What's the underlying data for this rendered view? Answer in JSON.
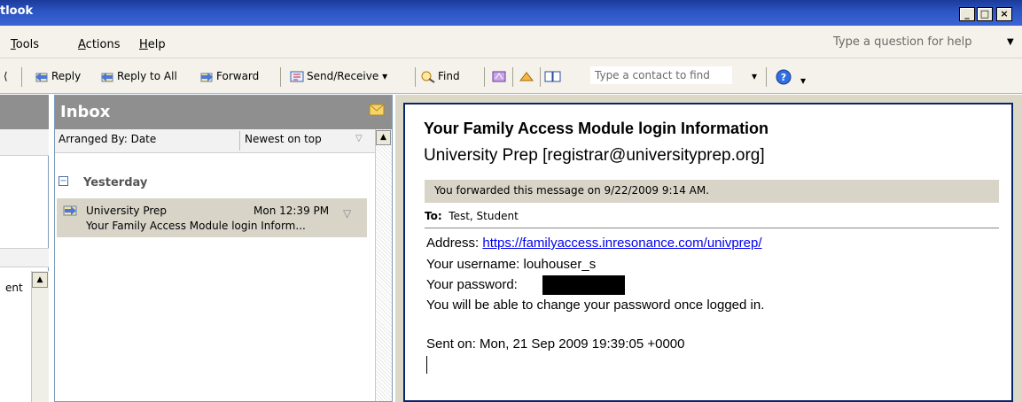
{
  "window": {
    "title": "tlook"
  },
  "menu": {
    "items": [
      "Tools",
      "Actions",
      "Help"
    ],
    "help_placeholder": "Type a question for help"
  },
  "toolbar": {
    "reply": "Reply",
    "reply_all": "Reply to All",
    "forward": "Forward",
    "send_receive": "Send/Receive",
    "find": "Find",
    "contact_placeholder": "Type a contact to find"
  },
  "folder_pane": {
    "item_partial": "ent"
  },
  "inbox": {
    "title": "Inbox",
    "arranged_by": "Arranged By: Date",
    "sort_order": "Newest on top",
    "group": "Yesterday",
    "messages": [
      {
        "from": "University Prep",
        "date": "Mon 12:39 PM",
        "subject": "Your Family Access Module login Inform..."
      }
    ]
  },
  "reading": {
    "subject": "Your Family Access Module login Information",
    "sender": "University Prep [registrar@universityprep.org]",
    "info": "You forwarded this message on 9/22/2009 9:14 AM.",
    "to_label": "To:",
    "to_value": "Test, Student",
    "address_label": "Address: ",
    "address_link": "https://familyaccess.inresonance.com/univprep/",
    "username": "Your username: louhouser_s",
    "password_label": "Your password:",
    "change_note": "You will be able to change your password once logged in.",
    "sent_on": "Sent on: Mon, 21 Sep 2009 19:39:05 +0000"
  },
  "colors": {
    "titlebar": "#2d55c4",
    "pane_header": "#8f8f8f",
    "selected_row": "#d8d4c8",
    "link": "#0000ee"
  }
}
